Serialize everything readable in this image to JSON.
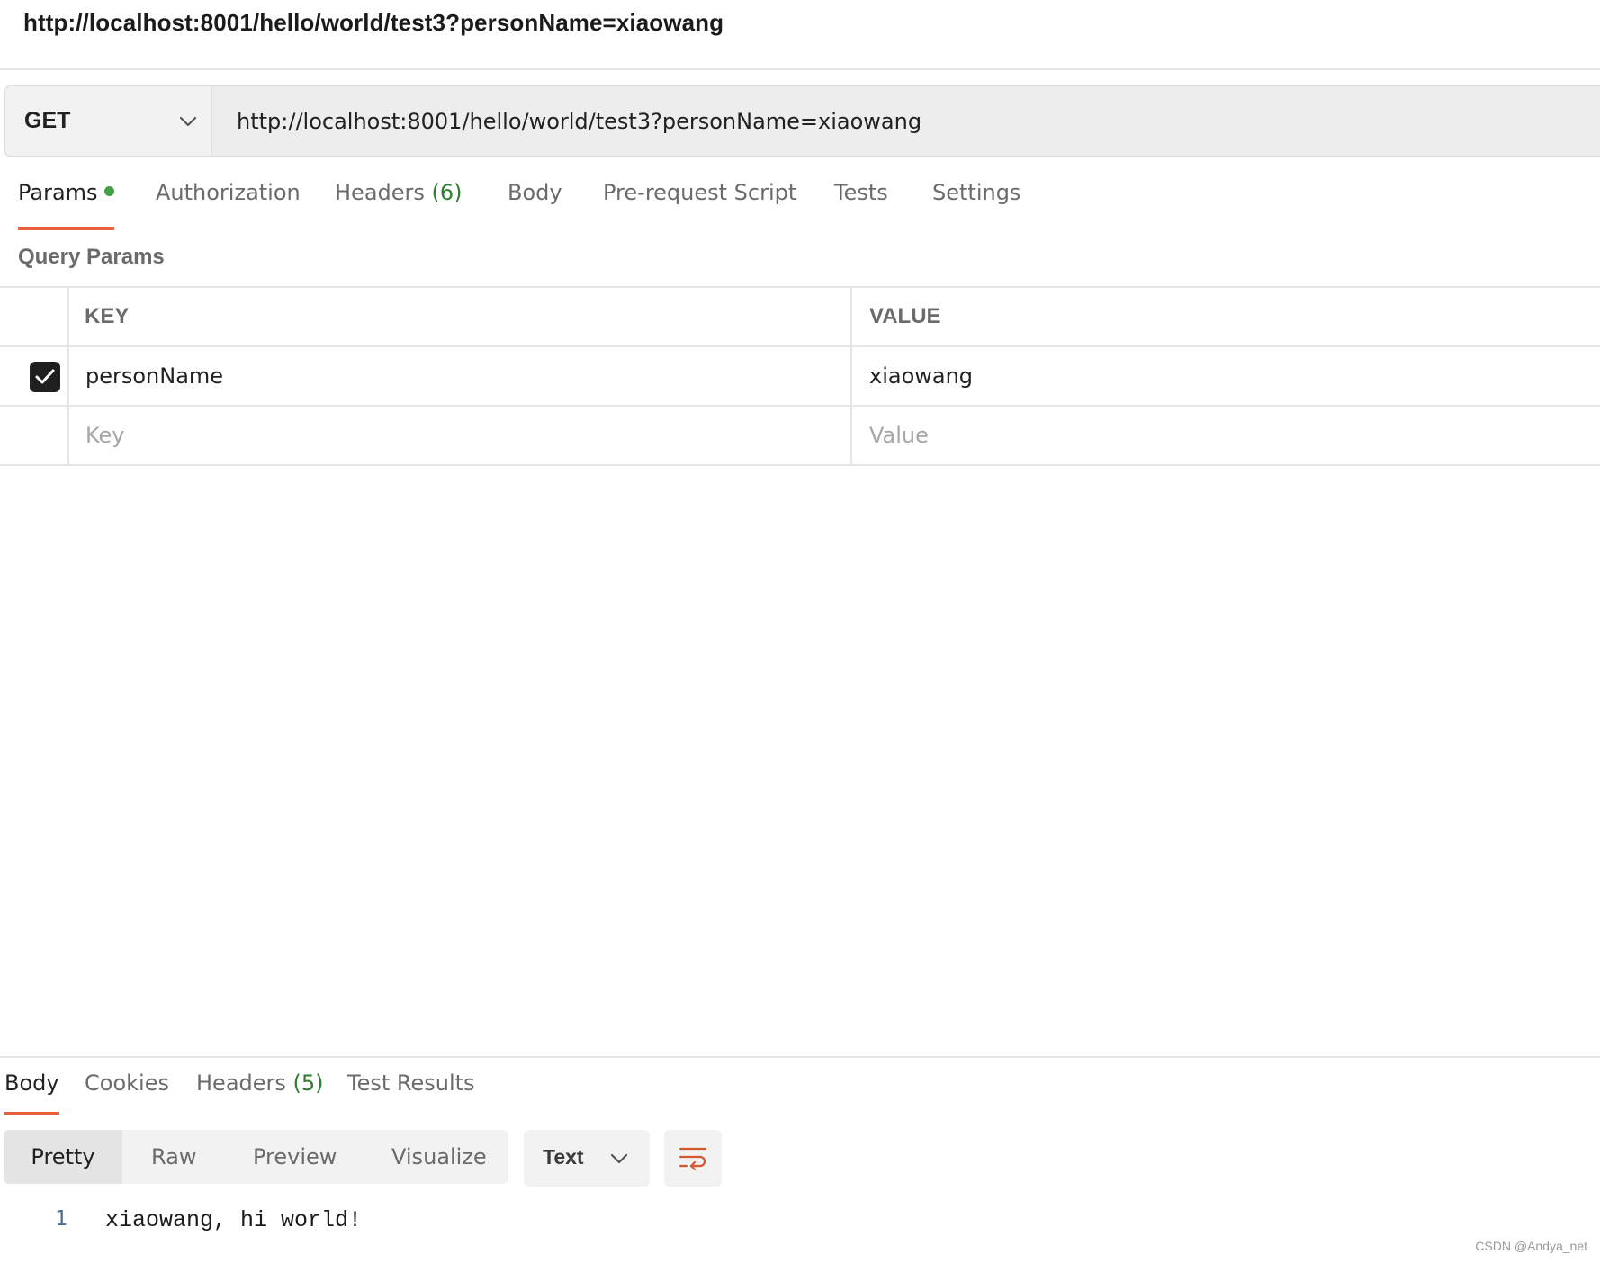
{
  "request": {
    "title": "http://localhost:8001/hello/world/test3?personName=xiaowang",
    "method": "GET",
    "url": "http://localhost:8001/hello/world/test3?personName=xiaowang"
  },
  "request_tabs": [
    {
      "label": "Params",
      "active": true
    },
    {
      "label": "Authorization"
    },
    {
      "label": "Headers",
      "count": "(6)"
    },
    {
      "label": "Body"
    },
    {
      "label": "Pre-request Script"
    },
    {
      "label": "Tests"
    },
    {
      "label": "Settings"
    }
  ],
  "query_params": {
    "title": "Query Params",
    "columns": {
      "key": "KEY",
      "value": "VALUE"
    },
    "rows": [
      {
        "checked": true,
        "key": "personName",
        "value": "xiaowang"
      }
    ],
    "new_row": {
      "key_placeholder": "Key",
      "value_placeholder": "Value"
    }
  },
  "response_tabs": [
    {
      "label": "Body",
      "active": true
    },
    {
      "label": "Cookies"
    },
    {
      "label": "Headers",
      "count": "(5)"
    },
    {
      "label": "Test Results"
    }
  ],
  "response_view": {
    "modes": [
      "Pretty",
      "Raw",
      "Preview",
      "Visualize"
    ],
    "active_mode": "Pretty",
    "format": "Text"
  },
  "response_body": [
    {
      "line": "1",
      "text": "xiaowang, hi world!"
    }
  ],
  "watermark": "CSDN @Andya_net",
  "colors": {
    "accent_underline": "#e8613b",
    "params_dot": "#43a047",
    "count_text": "#2e7d32"
  }
}
